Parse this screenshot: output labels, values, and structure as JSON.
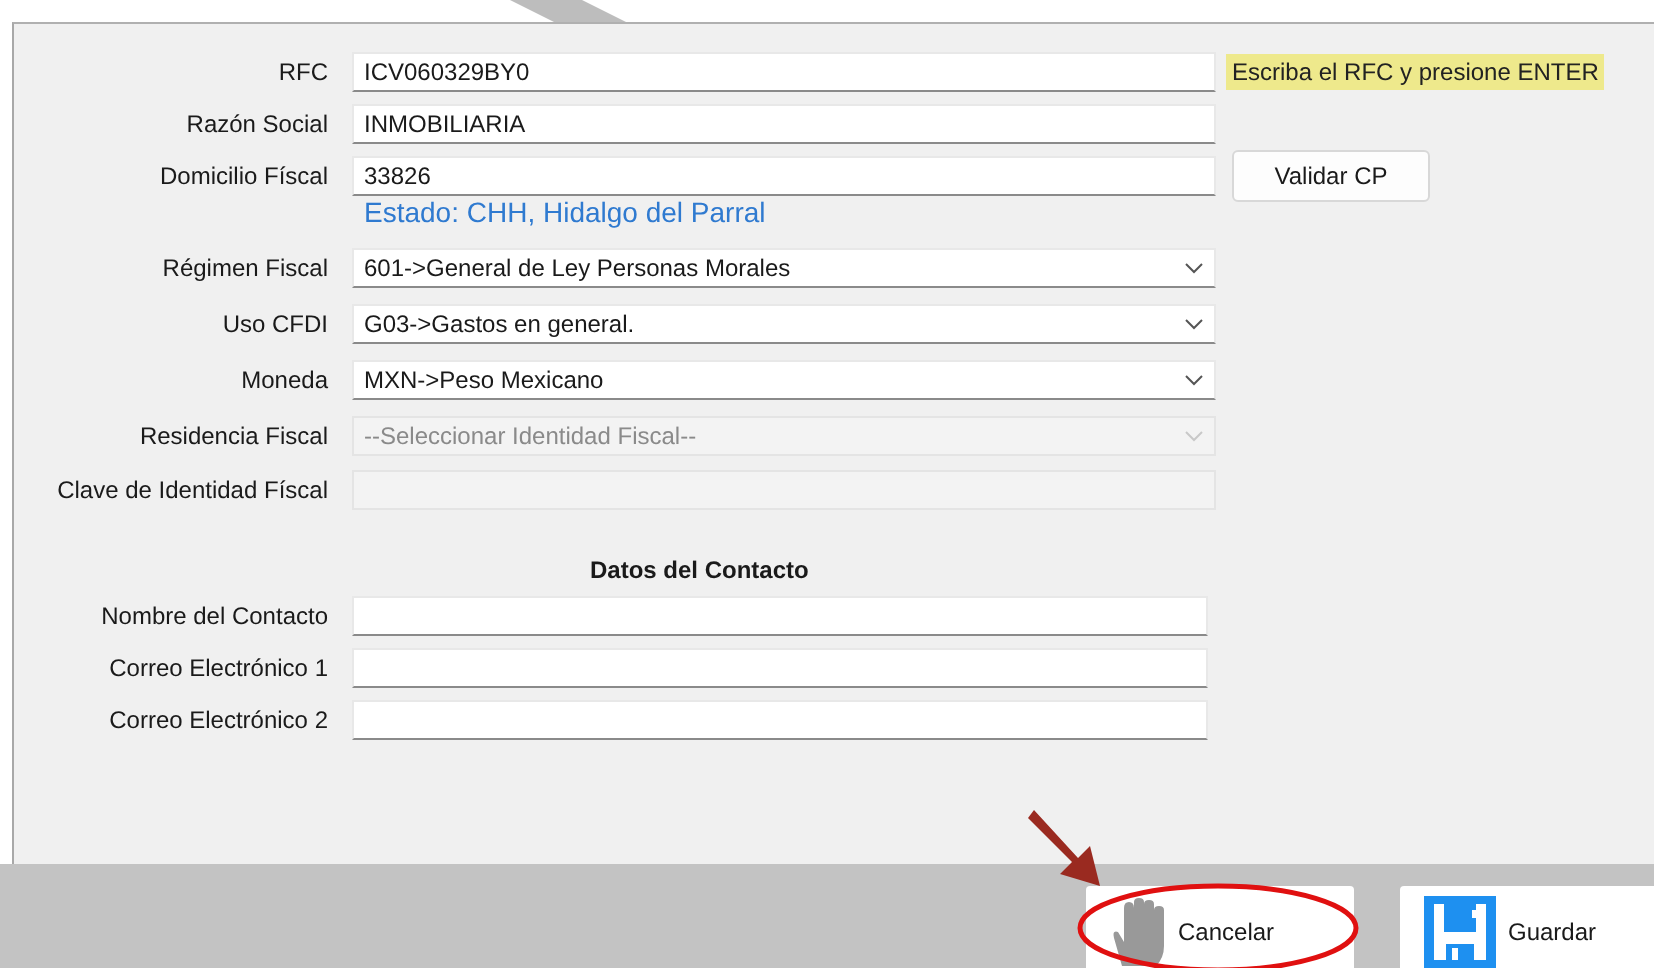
{
  "fields": [
    {
      "label": "RFC",
      "kind": "text",
      "value": "ICV060329BY0",
      "disabled": false,
      "hint": "Escriba el RFC y presione ENTER"
    },
    {
      "label": "Razón Social",
      "kind": "text",
      "value": "INMOBILIARIA",
      "disabled": false
    },
    {
      "label": "Domicilio Físcal",
      "kind": "text",
      "value": "33826",
      "disabled": false,
      "button": "Validar CP",
      "note": "Estado: CHH, Hidalgo del Parral"
    },
    {
      "label": "Régimen Fiscal",
      "kind": "select",
      "value": "601->General de Ley Personas Morales",
      "disabled": false
    },
    {
      "label": "Uso CFDI",
      "kind": "select",
      "value": "G03->Gastos en general.",
      "disabled": false
    },
    {
      "label": "Moneda",
      "kind": "select",
      "value": "MXN->Peso Mexicano",
      "disabled": false
    },
    {
      "label": "Residencia Fiscal",
      "kind": "select",
      "placeholder": "--Seleccionar Identidad Fiscal--",
      "disabled": true
    },
    {
      "label": "Clave de Identidad Físcal",
      "kind": "text",
      "disabled": true
    }
  ],
  "contact": {
    "title": "Datos del Contacto",
    "fields": [
      {
        "label": "Nombre del Contacto"
      },
      {
        "label": "Correo Electrónico 1"
      },
      {
        "label": "Correo Electrónico 2"
      }
    ]
  },
  "buttons": [
    {
      "label": "Cancelar",
      "kind": "cancel",
      "highlighted": true
    },
    {
      "label": "Guardar",
      "kind": "save",
      "highlighted": false
    }
  ]
}
